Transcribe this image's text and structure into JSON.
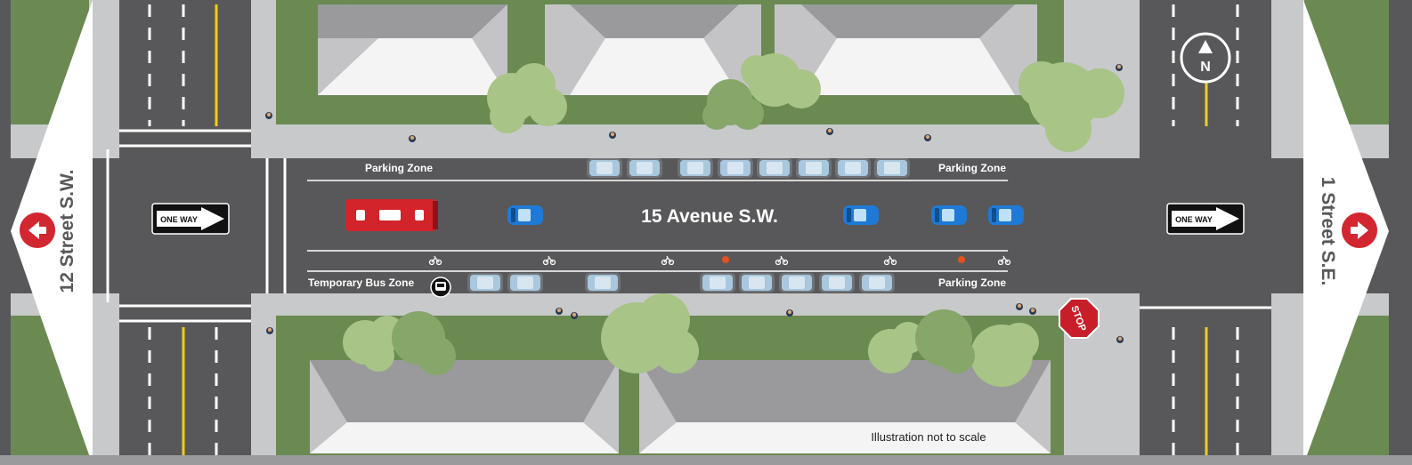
{
  "streets": {
    "main_avenue": "15 Avenue S.W.",
    "west_street": "12 Street S.W.",
    "east_street": "1 Street S.E."
  },
  "zones": {
    "north_west": "Parking Zone",
    "north_east": "Parking Zone",
    "south_west": "Temporary Bus Zone",
    "south_east": "Parking Zone"
  },
  "signs": {
    "one_way_west": "ONE WAY",
    "one_way_east": "ONE WAY",
    "stop": "STOP",
    "compass": "N"
  },
  "note": "Illustration not to scale",
  "colors": {
    "road": "#58585a",
    "sidewalk": "#c8c9cb",
    "grass": "#6a8a52",
    "roof_top": "#9a9a9c",
    "roof_side": "#c4c4c6",
    "tree_light": "#a8c486",
    "tree_dark": "#87a76a",
    "yellow_line": "#f2cc1b",
    "car_blue": "#1e7ad6",
    "car_parked": "#a9c7dd",
    "bus_red": "#d3232b",
    "stop_red": "#c81e2a",
    "arrow_red": "#d22630"
  },
  "icons": [
    "one-way-arrow-icon",
    "north-compass-icon",
    "stop-sign-icon",
    "bus-stop-icon",
    "bicycle-lane-icon",
    "direction-arrow-icon"
  ]
}
